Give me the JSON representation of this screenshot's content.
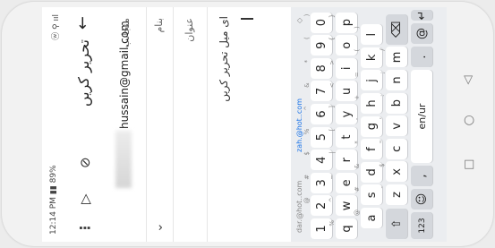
{
  "status_bar": {
    "time": "12:14 PM",
    "battery": "89%",
    "icons": "ⓦ ⚲ ııl"
  },
  "app_bar": {
    "title": "تحریر کریں",
    "back_icon": "back-arrow-icon",
    "attach_icon": "paperclip-icon",
    "send_icon": "send-icon",
    "more_icon": "more-vert-icon"
  },
  "from": {
    "label": "منجانب",
    "value": "hussain@gmail.com"
  },
  "to": {
    "label": "بنام"
  },
  "subject": {
    "label": "عنوان"
  },
  "body": {
    "text": "ای میل تحریر کریں"
  },
  "keyboard": {
    "suggestions": [
      "dar.@hot..com",
      "zah.@hot..com",
      "◇"
    ],
    "row_numbers": [
      [
        "1",
        ""
      ],
      [
        "2",
        "@"
      ],
      [
        "3",
        "#"
      ],
      [
        "4",
        "$"
      ],
      [
        "5",
        "%"
      ],
      [
        "6",
        "^"
      ],
      [
        "7",
        "&"
      ],
      [
        "8",
        "*"
      ],
      [
        "9",
        "("
      ],
      [
        "0",
        ")"
      ]
    ],
    "row_q": [
      [
        "q",
        "%"
      ],
      [
        "w",
        "^"
      ],
      [
        "e",
        "~"
      ],
      [
        "r",
        "|"
      ],
      [
        "t",
        "["
      ],
      [
        "y",
        "]"
      ],
      [
        "u",
        "<"
      ],
      [
        "i",
        ">"
      ],
      [
        "o",
        "{"
      ],
      [
        "p",
        "}"
      ]
    ],
    "row_a": [
      [
        "a",
        "@"
      ],
      [
        "s",
        "#"
      ],
      [
        "d",
        "&"
      ],
      [
        "f",
        "*"
      ],
      [
        "g",
        "-"
      ],
      [
        "h",
        "+"
      ],
      [
        "j",
        "="
      ],
      [
        "k",
        "("
      ],
      [
        "l",
        ")"
      ]
    ],
    "row_z": [
      [
        "z",
        "-"
      ],
      [
        "x",
        "$"
      ],
      [
        "c",
        "\""
      ],
      [
        "v",
        "'"
      ],
      [
        "b",
        ":"
      ],
      [
        "n",
        ";"
      ],
      [
        "m",
        "/"
      ]
    ],
    "shift": "⇧",
    "backspace": "⌫",
    "num_key": "123",
    "emoji_key": "☺",
    "comma": ",",
    "space_label": "en/ur",
    "period": ".",
    "at_key": "@",
    "enter": "↵",
    "lang_key": "▭"
  },
  "nav": {
    "back": "◁",
    "home": "○",
    "recents": "□"
  }
}
